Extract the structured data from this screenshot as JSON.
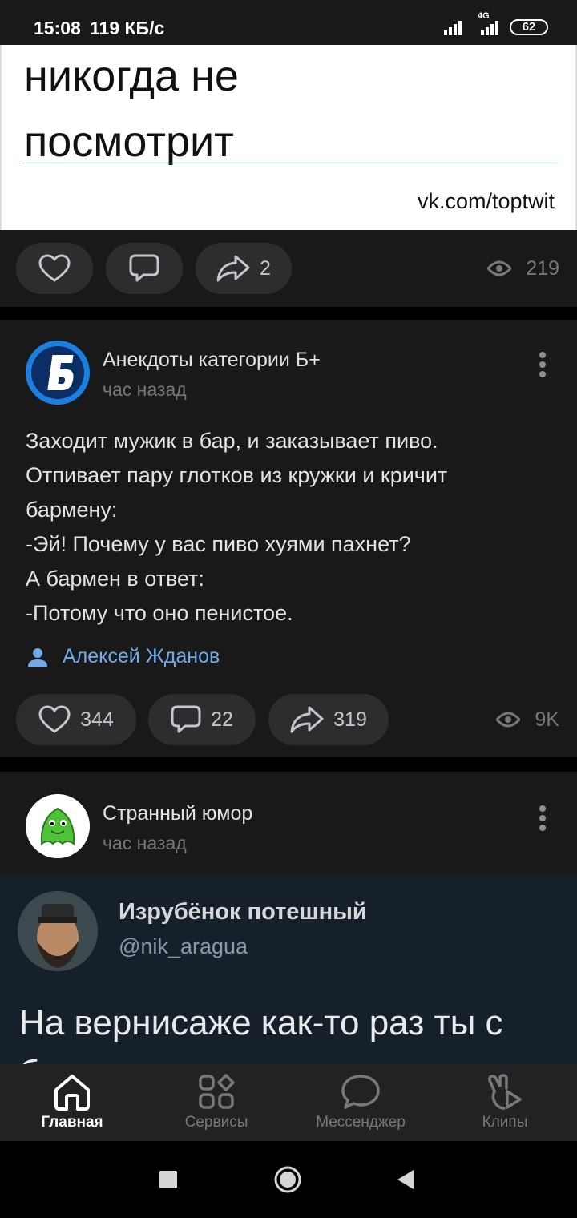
{
  "status_bar": {
    "time": "15:08",
    "speed": "119 КБ/с",
    "network": "4G",
    "battery": "62"
  },
  "post1": {
    "image_line1": "никогда не",
    "image_line2": "посмотрит",
    "image_watermark": "vk.com/toptwit",
    "likes": "",
    "comments": "",
    "shares": "2",
    "views": "219"
  },
  "post2": {
    "author": "Анекдоты категории Б+",
    "time": "час назад",
    "text_lines": [
      "Заходит мужик в бар, и заказывает пиво.",
      "Отпивает пару глотков из кружки и кричит",
      "бармену:",
      "-Эй! Почему у вас пиво хуями пахнет?",
      "А бармен в ответ:",
      "-Потому что оно пенистое."
    ],
    "signer": "Алексей Жданов",
    "likes": "344",
    "comments": "22",
    "shares": "319",
    "views": "9K"
  },
  "post3": {
    "author": "Странный юмор",
    "time": "час назад",
    "tweet_name": "Изрубёнок потешный",
    "tweet_handle": "@nik_aragua",
    "tweet_text_line1": "На вернисаже как-то раз ты с",
    "tweet_text_line2": "бизнесом познакомилась и я"
  },
  "tabbar": {
    "items": [
      {
        "label": "Главная",
        "icon": "home-icon",
        "active": true
      },
      {
        "label": "Сервисы",
        "icon": "services-icon",
        "active": false
      },
      {
        "label": "Мессенджер",
        "icon": "messenger-icon",
        "active": false
      },
      {
        "label": "Клипы",
        "icon": "clips-icon",
        "active": false
      }
    ]
  },
  "colors": {
    "accent": "#71aaeb",
    "card": "#19191a",
    "pill": "#2c2d2e"
  }
}
